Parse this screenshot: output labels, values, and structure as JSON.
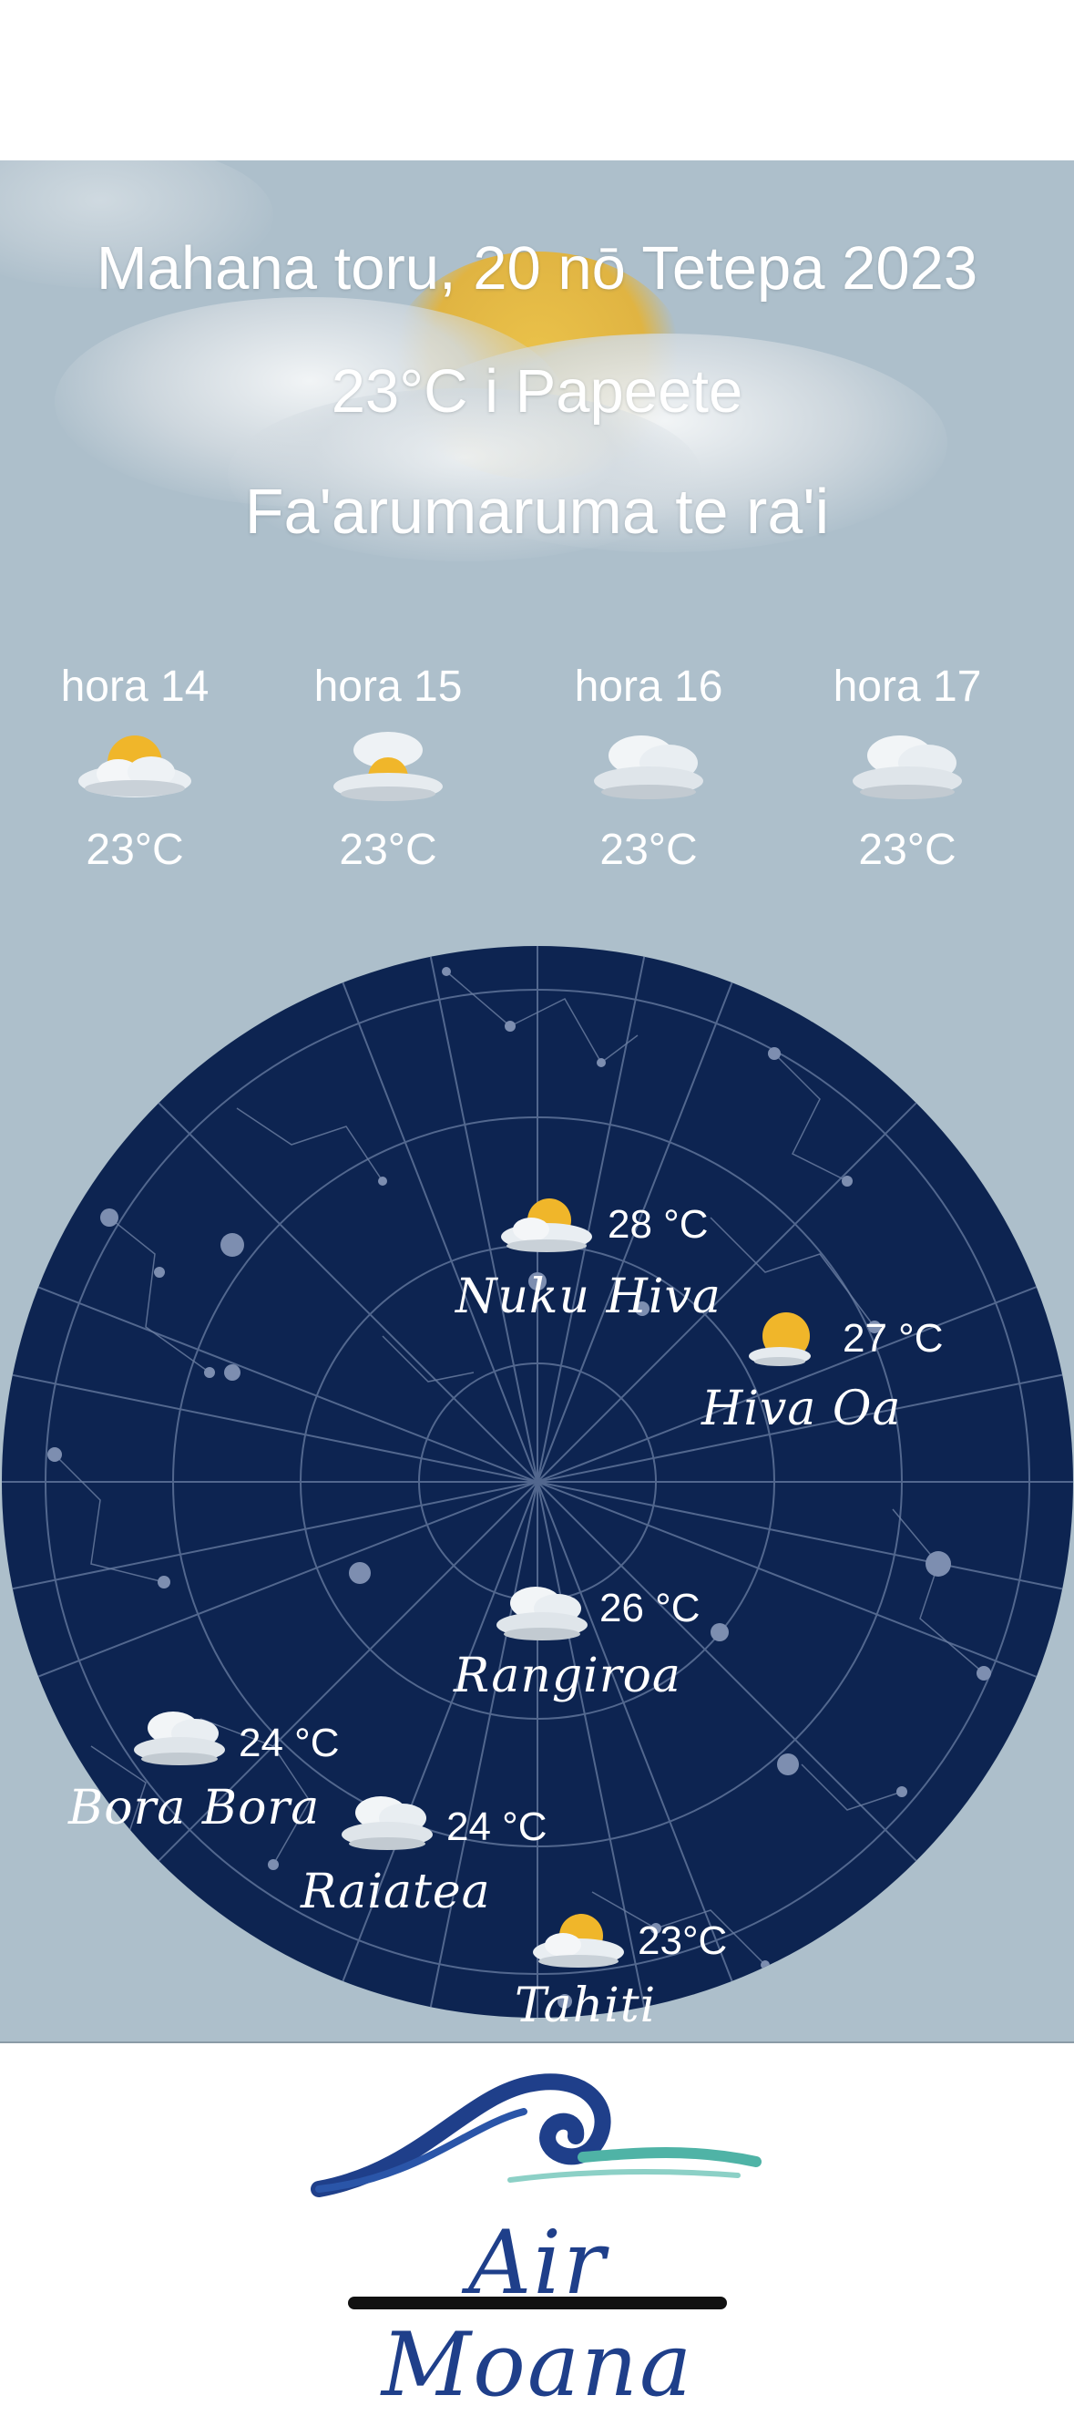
{
  "header": {
    "date": "Mahana toru, 20 nō Tetepa 2023",
    "temperature": "23°C i Papeete",
    "condition": "Fa'arumaruma te ra'i"
  },
  "hourly": [
    {
      "label": "hora 14",
      "temp": "23°C",
      "icon": "sun-behind-cloud-icon"
    },
    {
      "label": "hora 15",
      "temp": "23°C",
      "icon": "cloudy-sun-icon"
    },
    {
      "label": "hora 16",
      "temp": "23°C",
      "icon": "cloud-icon"
    },
    {
      "label": "hora 17",
      "temp": "23°C",
      "icon": "cloud-icon"
    }
  ],
  "stations": [
    {
      "name": "Nuku Hiva",
      "temp": "28 °C",
      "icon": "sun-behind-cloud-icon"
    },
    {
      "name": "Hiva Oa",
      "temp": "27 °C",
      "icon": "sun-small-cloud-icon"
    },
    {
      "name": "Rangiroa",
      "temp": "26 °C",
      "icon": "cloud-icon"
    },
    {
      "name": "Bora Bora",
      "temp": "24 °C",
      "icon": "cloud-icon"
    },
    {
      "name": "Raiatea",
      "temp": "24 °C",
      "icon": "cloud-icon"
    },
    {
      "name": "Tahiti",
      "temp": "23°C",
      "icon": "sun-behind-cloud-icon"
    }
  ],
  "footer": {
    "logo_text": "Air Moana"
  },
  "colors": {
    "panel_background": "#adbfcb",
    "map_background": "#0d2451",
    "logo_blue": "#1f3f8a",
    "logo_teal": "#4fb3a6"
  }
}
